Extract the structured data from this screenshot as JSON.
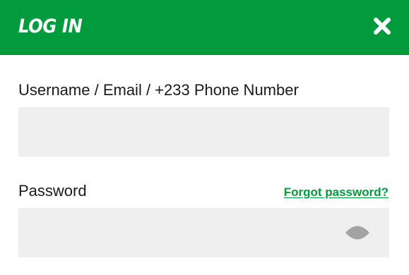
{
  "modal": {
    "title": "LOG IN",
    "close_icon": "close-icon",
    "header_color": "#019a3d"
  },
  "username": {
    "label": "Username / Email / +233 Phone Number",
    "value": "",
    "placeholder": ""
  },
  "password": {
    "label": "Password",
    "value": "",
    "placeholder": "",
    "forgot_label": "Forgot password?",
    "toggle_icon": "eye-icon"
  }
}
